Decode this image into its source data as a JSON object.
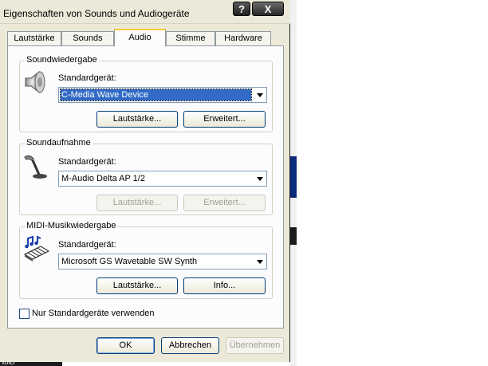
{
  "window": {
    "title": "Eigenschaften von Sounds und Audiogeräte"
  },
  "titlebar_buttons": {
    "help": "?",
    "close": "X"
  },
  "tabs": [
    {
      "label": "Lautstärke"
    },
    {
      "label": "Sounds"
    },
    {
      "label": "Audio"
    },
    {
      "label": "Stimme"
    },
    {
      "label": "Hardware"
    }
  ],
  "playback": {
    "title": "Soundwiedergabe",
    "default_label": "Standardgerät:",
    "device": "C-Media Wave Device",
    "volume_button": "Lautstärke...",
    "advanced_button": "Erweitert..."
  },
  "recording": {
    "title": "Soundaufnahme",
    "default_label": "Standardgerät:",
    "device": "M-Audio Delta AP 1/2",
    "volume_button": "Lautstärke...",
    "advanced_button": "Erweitert..."
  },
  "midi": {
    "title": "MIDI-Musikwiedergabe",
    "default_label": "Standardgerät:",
    "device": "Microsoft GS Wavetable SW Synth",
    "volume_button": "Lautstärke...",
    "info_button": "Info..."
  },
  "only_default_checkbox": {
    "label": "Nur Standardgeräte verwenden",
    "checked": false
  },
  "footer": {
    "ok": "OK",
    "cancel": "Abbrechen",
    "apply": "Übernehmen"
  },
  "background": {
    "fragment_text": "xofD"
  }
}
